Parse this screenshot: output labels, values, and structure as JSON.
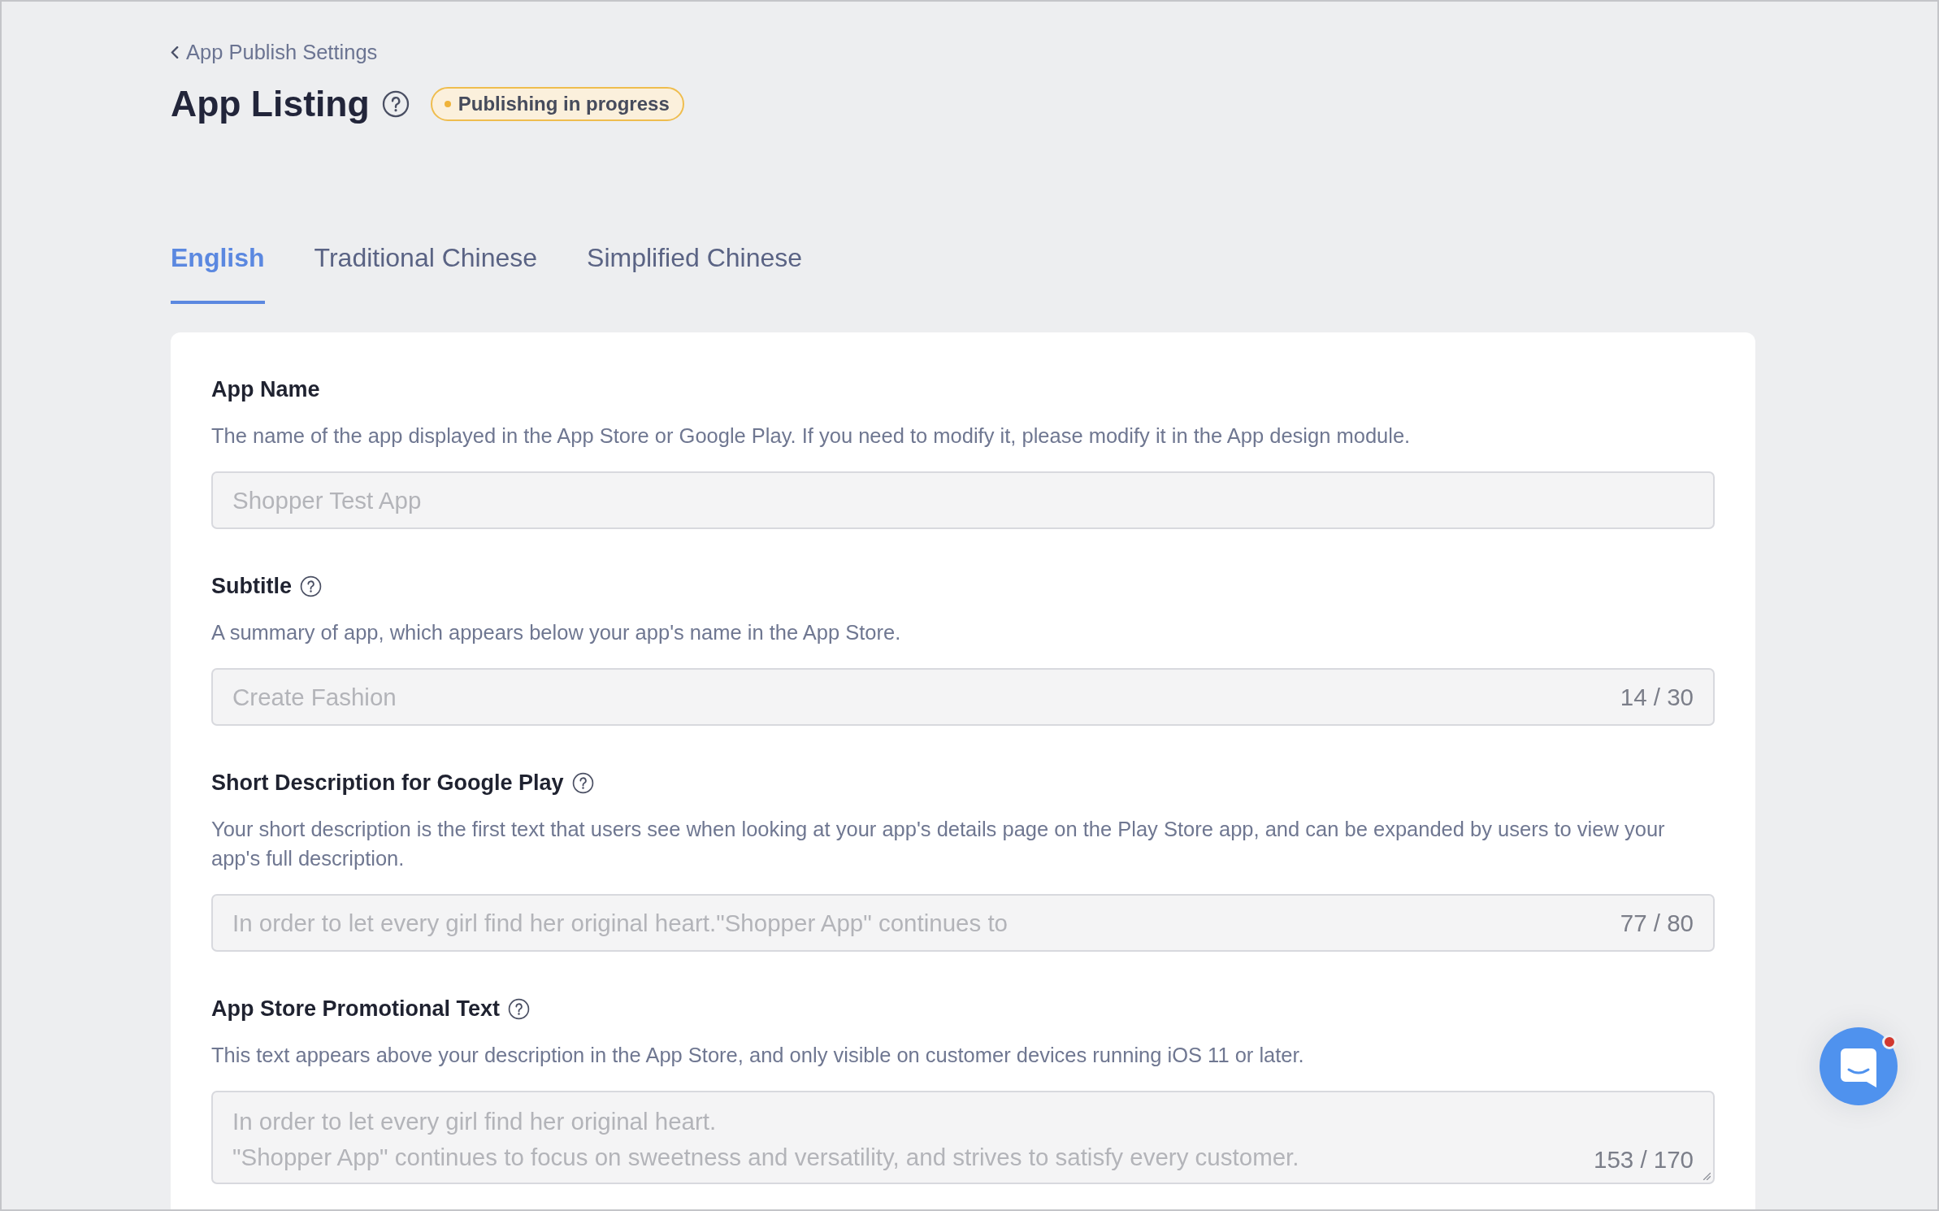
{
  "breadcrumb": {
    "label": "App Publish Settings"
  },
  "header": {
    "title": "App Listing",
    "help": true,
    "status": {
      "kind": "in_progress",
      "label": "Publishing in progress"
    }
  },
  "tabs": [
    {
      "label": "English",
      "selected": true
    },
    {
      "label": "Traditional Chinese",
      "selected": false
    },
    {
      "label": "Simplified Chinese",
      "selected": false
    }
  ],
  "fields": [
    {
      "kind": "input",
      "label": "App Name",
      "help": false,
      "description": "The name of the app displayed in the App Store or Google Play. If you need to modify it, please modify it in the App design module.",
      "value": "Shopper Test App",
      "disabled": true
    },
    {
      "kind": "input",
      "label": "Subtitle",
      "help": true,
      "description": "A summary of app, which appears below your app's name in the App Store.",
      "value": "Create Fashion",
      "counter": "14 / 30",
      "disabled": true
    },
    {
      "kind": "input",
      "label": "Short Description for Google Play",
      "help": true,
      "description": "Your short description is the first text that users see when looking at your app's details page on the Play Store app, and can be expanded by users to view your app's full description.",
      "value": "In order to let every girl find her original heart.\"Shopper App\" continues to",
      "counter": "77 / 80",
      "disabled": true
    },
    {
      "kind": "textarea",
      "label": "App Store Promotional Text",
      "help": true,
      "description": "This text appears above your description in the App Store, and only visible on customer devices running iOS 11 or later.",
      "value": "In order to let every girl find her original heart.\n\"Shopper App\" continues to focus on sweetness and versatility, and strives to satisfy every customer.",
      "counter": "153 / 170",
      "disabled": true
    }
  ],
  "chat": {
    "unread": true
  }
}
